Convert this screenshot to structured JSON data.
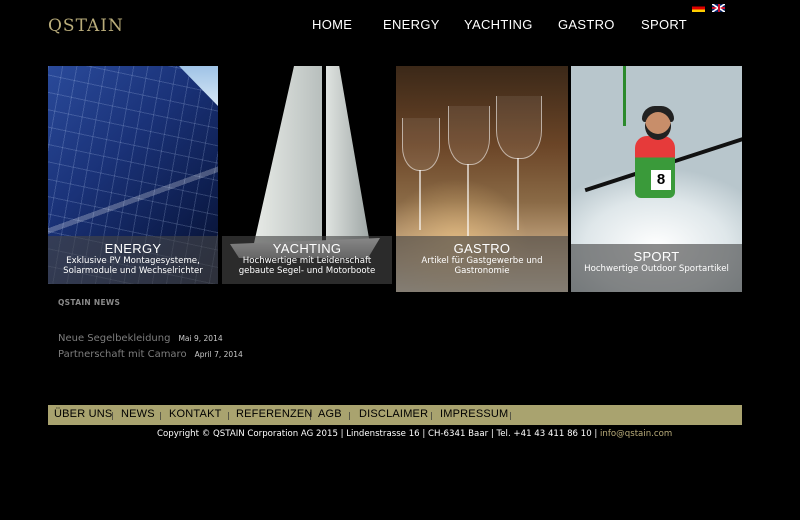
{
  "brand": {
    "logo": "QSTAIN"
  },
  "nav": [
    "HOME",
    "ENERGY",
    "YACHTING",
    "GASTRO",
    "SPORT"
  ],
  "languages": [
    "de-flag-icon",
    "en-flag-icon"
  ],
  "tiles": [
    {
      "title": "ENERGY",
      "desc": "Exklusive PV Montagesysteme, Solarmodule und Wechselrichter"
    },
    {
      "title": "YACHTING",
      "desc": "Hochwertige mit Leidenschaft gebaute Segel- und Motorboote"
    },
    {
      "title": "GASTRO",
      "desc": "Artikel für Gastgewerbe und Gastronomie"
    },
    {
      "title": "SPORT",
      "desc": "Hochwertige Outdoor Sportartikel"
    }
  ],
  "news": {
    "heading": "QSTAIN NEWS",
    "items": [
      {
        "title": "Neue Segelbekleidung",
        "date": "Mai 9, 2014"
      },
      {
        "title": "Partnerschaft mit Camaro",
        "date": "April 7, 2014"
      }
    ]
  },
  "footer": {
    "links": [
      "ÜBER UNS",
      "NEWS",
      "KONTAKT",
      "REFERENZEN",
      "AGB",
      "DISCLAIMER",
      "IMPRESSUM"
    ],
    "separator": "|",
    "copyright": "Copyright © QSTAIN Corporation AG 2015 | Lindenstrasse 16 | CH-6341 Baar | Tel. +41 43 411 86 10 | ",
    "email": "info@qstain.com"
  },
  "colors": {
    "accent": "#b9ac7a",
    "footer_bar": "#a9a36f",
    "background": "#000000"
  }
}
